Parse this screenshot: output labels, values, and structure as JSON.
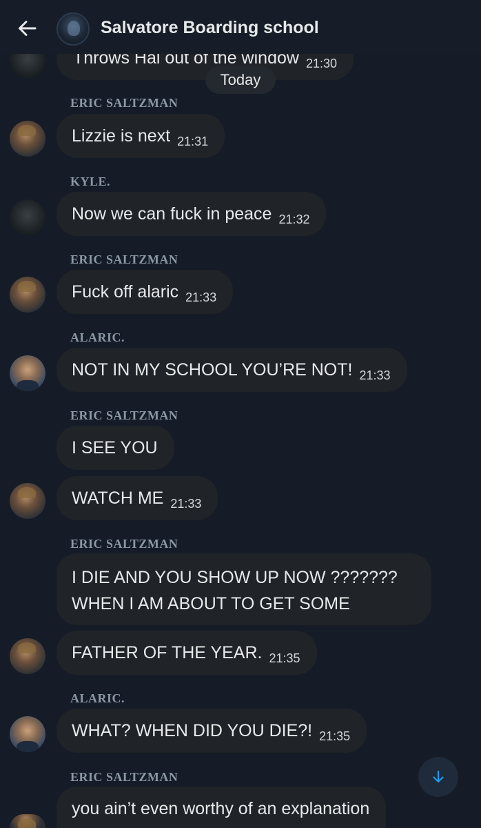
{
  "header": {
    "title": "Salvatore Boarding school"
  },
  "date_separator": "Today",
  "first_message": {
    "text": "Throws Hal out of the window",
    "time": "21:30"
  },
  "messages": [
    {
      "sender": "ERIC SALTZMAN",
      "text": "Lizzie is next",
      "time": "21:31"
    },
    {
      "sender": "KYLE.",
      "text": "Now we can fuck in peace",
      "time": "21:32"
    },
    {
      "sender": "ERIC SALTZMAN",
      "text": "Fuck off alaric",
      "time": "21:33"
    },
    {
      "sender": "ALARIC.",
      "text": "NOT IN MY SCHOOL YOU’RE NOT!",
      "time": "21:33"
    },
    {
      "sender": "ERIC SALTZMAN",
      "text": "I SEE YOU",
      "time": ""
    },
    {
      "sender": "",
      "text": "WATCH ME",
      "time": "21:33"
    },
    {
      "sender": "ERIC SALTZMAN",
      "text_line1": "I DIE AND YOU SHOW UP NOW ???????",
      "text_line2": "WHEN I AM ABOUT TO GET SOME",
      "time": ""
    },
    {
      "sender": "",
      "text": "FATHER OF THE YEAR.",
      "time": "21:35"
    },
    {
      "sender": "ALARIC.",
      "text": "WHAT? WHEN DID YOU DIE?!",
      "time": "21:35"
    },
    {
      "sender": "ERIC SALTZMAN",
      "text": "you ain’t even worthy of an explanation",
      "time": ""
    }
  ],
  "icons": {
    "back": "arrow-left-icon",
    "scroll": "arrow-down-icon"
  },
  "colors": {
    "background": "#151c27",
    "bubble": "#202328",
    "sender": "#8b98a5",
    "accent": "#1d9bf0"
  }
}
